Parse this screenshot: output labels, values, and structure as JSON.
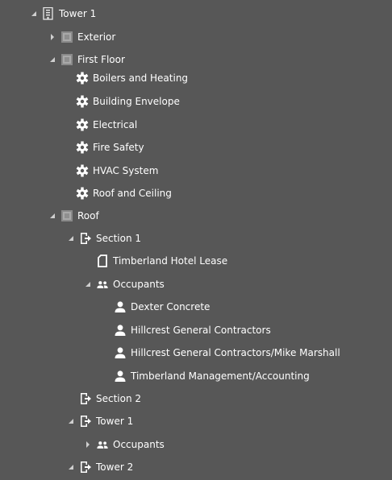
{
  "tree": {
    "root": {
      "label": "Tower 1",
      "icon": "building-icon",
      "expanded": true
    },
    "exterior": {
      "label": "Exterior",
      "icon": "floor-icon",
      "expanded": false
    },
    "first_floor": {
      "label": "First Floor",
      "icon": "floor-icon",
      "expanded": true,
      "systems": [
        {
          "label": "Boilers and Heating",
          "icon": "gear-icon"
        },
        {
          "label": "Building Envelope",
          "icon": "gear-icon"
        },
        {
          "label": "Electrical",
          "icon": "gear-icon"
        },
        {
          "label": "Fire Safety",
          "icon": "gear-icon"
        },
        {
          "label": "HVAC System",
          "icon": "gear-icon"
        },
        {
          "label": "Roof and Ceiling",
          "icon": "gear-icon"
        }
      ]
    },
    "roof": {
      "label": "Roof",
      "icon": "floor-icon",
      "expanded": true
    },
    "section1": {
      "label": "Section 1",
      "icon": "door-exit-icon",
      "expanded": true
    },
    "lease": {
      "label": "Timberland Hotel Lease",
      "icon": "document-icon"
    },
    "occupants1": {
      "label": "Occupants",
      "icon": "people-icon",
      "expanded": true
    },
    "people": [
      {
        "label": "Dexter Concrete",
        "icon": "person-icon"
      },
      {
        "label": "Hillcrest General Contractors",
        "icon": "person-icon"
      },
      {
        "label": "Hillcrest General Contractors/Mike Marshall",
        "icon": "person-icon"
      },
      {
        "label": "Timberland Management/Accounting",
        "icon": "person-icon"
      }
    ],
    "section2": {
      "label": "Section 2",
      "icon": "door-exit-icon",
      "expanded": false
    },
    "tower1_sub": {
      "label": "Tower 1",
      "icon": "door-exit-icon",
      "expanded": true
    },
    "occupants2": {
      "label": "Occupants",
      "icon": "people-icon",
      "expanded": false
    },
    "tower2": {
      "label": "Tower 2",
      "icon": "door-exit-icon",
      "expanded": true
    }
  }
}
